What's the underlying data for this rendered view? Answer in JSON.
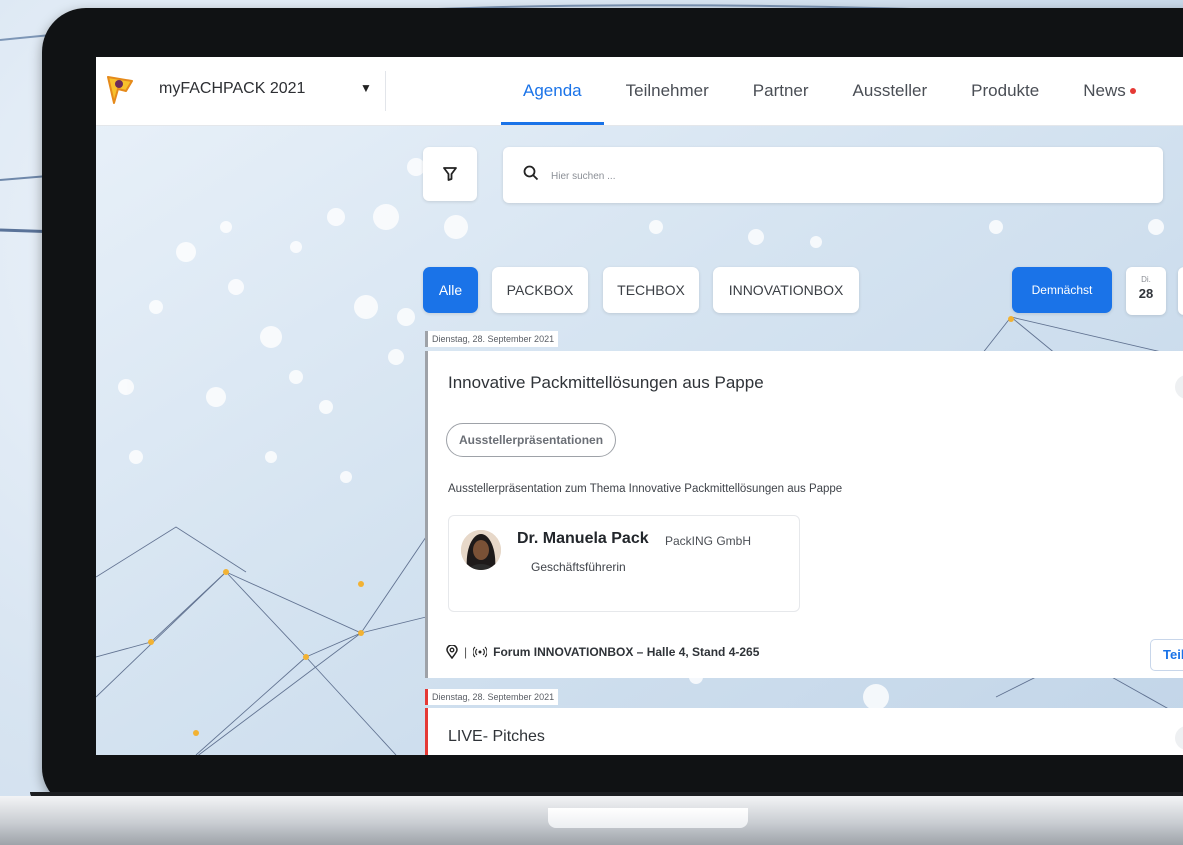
{
  "header": {
    "event_name": "myFACHPACK 2021",
    "nav": [
      {
        "label": "Agenda",
        "active": true
      },
      {
        "label": "Teilnehmer",
        "active": false
      },
      {
        "label": "Partner",
        "active": false
      },
      {
        "label": "Aussteller",
        "active": false
      },
      {
        "label": "Produkte",
        "active": false
      },
      {
        "label": "News",
        "active": false,
        "has_notification": true
      }
    ]
  },
  "search": {
    "placeholder": "Hier suchen ..."
  },
  "filters": {
    "categories": [
      "Alle",
      "PACKBOX",
      "TECHBOX",
      "INNOVATIONBOX"
    ],
    "active_category": "Alle",
    "upcoming_label": "Demnächst",
    "date_chip": {
      "weekday": "Di.",
      "day": "28"
    }
  },
  "sessions": [
    {
      "date": "Dienstag, 28. September 2021",
      "title": "Innovative Packmittellösungen aus Pappe",
      "tag": "Ausstellerpräsentationen",
      "description": "Ausstellerpräsentation zum Thema Innovative Packmittellösungen aus Pappe",
      "speaker": {
        "name": "Dr. Manuela Pack",
        "company": "PackING GmbH",
        "role": "Geschäftsführerin"
      },
      "location": "Forum INNOVATIONBOX – Halle 4, Stand 4-265",
      "join_label": "Teil"
    },
    {
      "date": "Dienstag, 28. September 2021",
      "title": "LIVE- Pitches"
    }
  ],
  "colors": {
    "accent": "#1a73e8",
    "live_marker": "#e53935",
    "notification": "#e53935"
  },
  "icons": [
    "filter-icon",
    "search-icon",
    "location-pin-icon",
    "broadcast-icon",
    "caret-down-icon",
    "logo-icon"
  ]
}
